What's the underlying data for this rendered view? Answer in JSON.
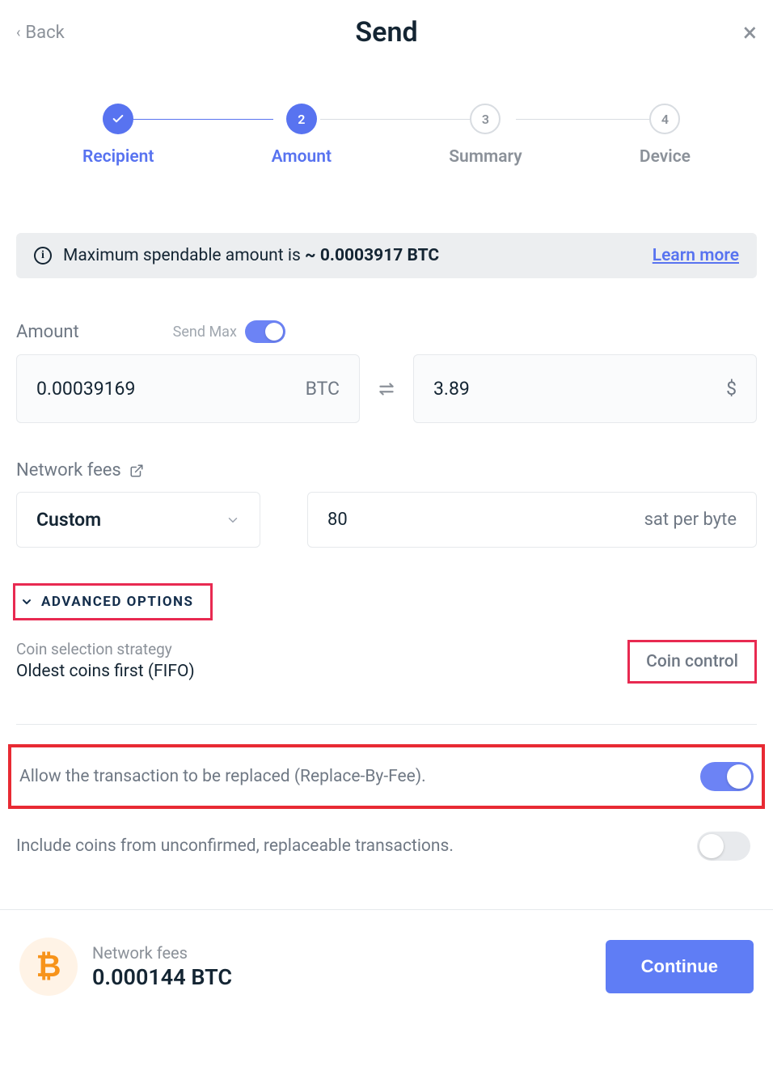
{
  "header": {
    "back_label": "Back",
    "title": "Send"
  },
  "stepper": {
    "steps": [
      {
        "label": "Recipient",
        "num": "✓"
      },
      {
        "label": "Amount",
        "num": "2"
      },
      {
        "label": "Summary",
        "num": "3"
      },
      {
        "label": "Device",
        "num": "4"
      }
    ]
  },
  "banner": {
    "prefix": "Maximum spendable amount is ",
    "amount": "~ 0.0003917 BTC",
    "learn_more": "Learn more"
  },
  "amount": {
    "label": "Amount",
    "send_max_label": "Send Max",
    "crypto_value": "0.00039169",
    "crypto_unit": "BTC",
    "fiat_value": "3.89",
    "fiat_unit": "$"
  },
  "fees": {
    "label": "Network fees",
    "strategy": "Custom",
    "rate_value": "80",
    "rate_unit": "sat per byte"
  },
  "advanced": {
    "toggle_label": "ADVANCED OPTIONS",
    "coin_strategy_label": "Coin selection strategy",
    "coin_strategy_value": "Oldest coins first (FIFO)",
    "coin_control_label": "Coin control",
    "rbf_label": "Allow the transaction to be replaced (Replace-By-Fee).",
    "unconfirmed_label": "Include coins from unconfirmed, replaceable transactions."
  },
  "footer": {
    "fees_label": "Network fees",
    "fees_value": "0.000144 BTC",
    "continue_label": "Continue"
  }
}
